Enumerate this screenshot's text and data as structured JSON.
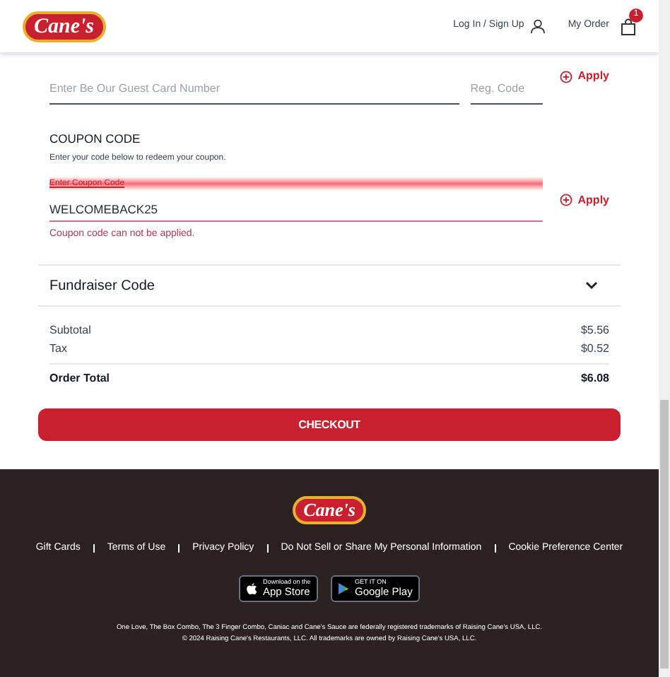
{
  "header": {
    "logo": "Cane's",
    "login": "Log In / Sign Up",
    "my_order": "My Order",
    "cart_count": "1"
  },
  "guest_card": {
    "card_placeholder": "Enter Be Our Guest Card Number",
    "reg_placeholder": "Reg. Code",
    "apply": "Apply"
  },
  "coupon": {
    "title": "COUPON CODE",
    "hint": "Enter your code below to redeem your coupon.",
    "label": "Enter Coupon Code",
    "value": "WELCOMEBACK25",
    "error": "Coupon code can not be applied.",
    "apply": "Apply"
  },
  "fundraiser": {
    "title": "Fundraiser Code",
    "expanded": false
  },
  "summary": [
    {
      "label": "Subtotal",
      "value": "$5.56",
      "total": false
    },
    {
      "label": "Tax",
      "value": "$0.52",
      "total": false
    },
    {
      "label": "Order Total",
      "value": "$6.08",
      "total": true
    }
  ],
  "checkout": "CHECKOUT",
  "footer": {
    "logo": "Cane's",
    "links": [
      "Gift Cards",
      "Terms of Use",
      "Privacy Policy",
      "Do Not Sell or Share My Personal Information",
      "Cookie Preference Center"
    ],
    "app_store": {
      "small": "Download on the",
      "big": "App Store"
    },
    "google_play": {
      "small": "GET IT ON",
      "big": "Google Play"
    },
    "legal": [
      "One Love, The Box Combo, The 3 Finger Combo, Caniac and Cane's Sauce are federally registered trademarks of Raising Cane's USA, LLC.",
      "© 2024 Raising Cane's Restaurants, LLC. All trademarks are owned by Raising Cane's USA, LLC."
    ]
  }
}
